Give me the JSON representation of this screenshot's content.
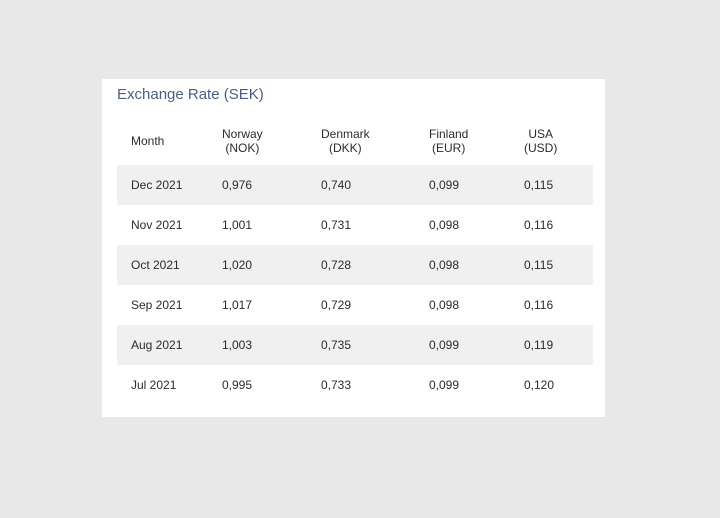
{
  "title": "Exchange Rate (SEK)",
  "columns": [
    {
      "line1": "Month",
      "line2": ""
    },
    {
      "line1": "Norway",
      "line2": "(NOK)"
    },
    {
      "line1": "Denmark",
      "line2": "(DKK)"
    },
    {
      "line1": "Finland",
      "line2": "(EUR)"
    },
    {
      "line1": "USA",
      "line2": "(USD)"
    }
  ],
  "rows": [
    [
      "Dec 2021",
      "0,976",
      "0,740",
      "0,099",
      "0,115"
    ],
    [
      "Nov 2021",
      "1,001",
      "0,731",
      "0,098",
      "0,116"
    ],
    [
      "Oct 2021",
      "1,020",
      "0,728",
      "0,098",
      "0,115"
    ],
    [
      "Sep 2021",
      "1,017",
      "0,729",
      "0,098",
      "0,116"
    ],
    [
      "Aug 2021",
      "1,003",
      "0,735",
      "0,099",
      "0,119"
    ],
    [
      "Jul 2021",
      "0,995",
      "0,733",
      "0,099",
      "0,120"
    ]
  ]
}
